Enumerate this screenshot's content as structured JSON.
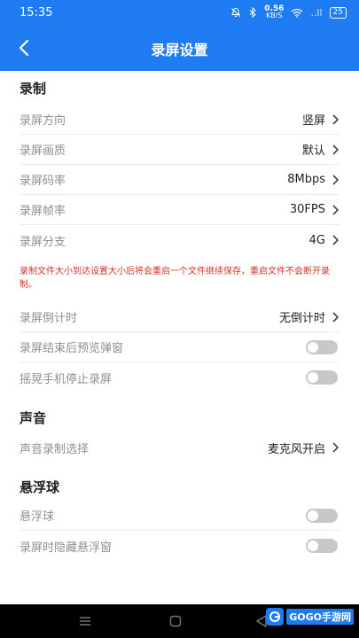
{
  "status_bar": {
    "time": "15:35",
    "net_speed_value": "0.56",
    "net_speed_unit": "KB/S",
    "signal": "..ll",
    "battery": "25"
  },
  "header": {
    "title": "录屏设置"
  },
  "sections": {
    "record": {
      "title": "录制",
      "direction": {
        "label": "录屏方向",
        "value": "竖屏"
      },
      "quality": {
        "label": "录屏画质",
        "value": "默认"
      },
      "bitrate": {
        "label": "录屏码率",
        "value": "8Mbps"
      },
      "fps": {
        "label": "录屏帧率",
        "value": "30FPS"
      },
      "split": {
        "label": "录屏分支",
        "value": "4G"
      },
      "warning": "录制文件大小到达设置大小后将会重启一个文件继续保存，重启文件不会断开录制。",
      "countdown": {
        "label": "录屏倒计时",
        "value": "无倒计时"
      },
      "preview_popup": {
        "label": "录屏结束后预览弹窗",
        "enabled": false
      },
      "shake_stop": {
        "label": "摇晃手机停止录屏",
        "enabled": false
      }
    },
    "sound": {
      "title": "声音",
      "source": {
        "label": "声音录制选择",
        "value": "麦克风开启"
      }
    },
    "float_ball": {
      "title": "悬浮球",
      "ball": {
        "label": "悬浮球",
        "enabled": false
      },
      "hide_on_record": {
        "label": "录屏时隐藏悬浮窗",
        "enabled": false
      }
    }
  },
  "watermark": {
    "text": "GOGO手游网"
  },
  "colors": {
    "primary": "#1e7bf1",
    "warning": "#d0342c",
    "label_gray": "#8f8f8f",
    "toggle_off": "#c8c8c8"
  }
}
